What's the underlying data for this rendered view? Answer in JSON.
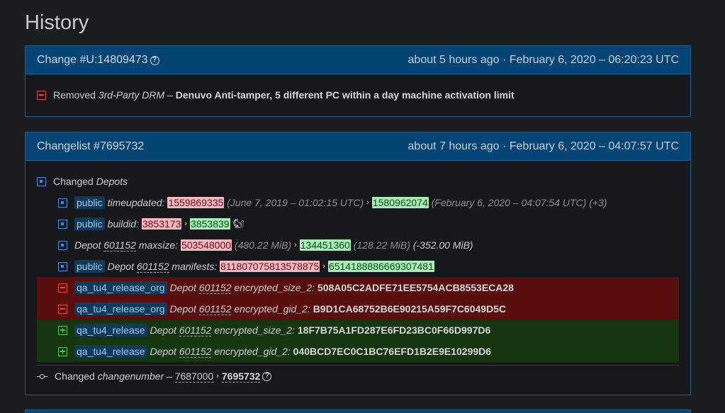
{
  "page": {
    "title": "History"
  },
  "change1": {
    "title": "Change #U:14809473",
    "time": "about 5 hours ago · February 6, 2020 – 06:20:23 UTC",
    "row": {
      "action": "Removed",
      "category": "3rd-Party DRM",
      "dash": "–",
      "value": "Denuvo Anti-tamper, 5 different PC within a day machine activation limit"
    }
  },
  "change2": {
    "title": "Changelist #7695732",
    "time": "about 7 hours ago · February 6, 2020 – 04:07:57 UTC",
    "depots_header": {
      "action": "Changed",
      "category": "Depots"
    },
    "rows": {
      "r1": {
        "tag": "public",
        "key": "timeupdated:",
        "old": "1559869335",
        "old_note": "(June 7, 2019 – 01:02:15 UTC)",
        "new": "1580962074",
        "new_note": "(February 6, 2020 – 04:07:54 UTC) (+3)"
      },
      "r2": {
        "tag": "public",
        "key": "buildid:",
        "old": "3853173",
        "new": "3853839",
        "icon": "squirrel-icon"
      },
      "r3": {
        "depot_label": "Depot",
        "depot_id": "601152",
        "key": "maxsize:",
        "old": "503548000",
        "old_note": "(480.22 MiB)",
        "new": "134451360",
        "new_note": "(128.22 MiB)",
        "delta": "(-352.00 MiB)"
      },
      "r4": {
        "tag": "public",
        "depot_label": "Depot",
        "depot_id": "601152",
        "key": "manifests:",
        "old": "811807075813578875",
        "new": "6514188886669307481"
      },
      "r5": {
        "tag": "qa_tu4_release_org",
        "depot_label": "Depot",
        "depot_id": "601152",
        "key": "encrypted_size_2:",
        "value": "508A05C2ADFE71EE5754ACB8553ECA28"
      },
      "r6": {
        "tag": "qa_tu4_release_org",
        "depot_label": "Depot",
        "depot_id": "601152",
        "key": "encrypted_gid_2:",
        "value": "B9D1CA68752B6E90215A59F7C6049D5C"
      },
      "r7": {
        "tag": "qa_tu4_release",
        "depot_label": "Depot",
        "depot_id": "601152",
        "key": "encrypted_size_2:",
        "value": "18F7B75A1FD287E6FD23BC0F66D997D6"
      },
      "r8": {
        "tag": "qa_tu4_release",
        "depot_label": "Depot",
        "depot_id": "601152",
        "key": "encrypted_gid_2:",
        "value": "040BCD7EC0C1BC76EFD1B2E9E10299D6"
      }
    },
    "changenumber": {
      "action": "Changed",
      "key": "changenumber",
      "dash": "–",
      "old": "7687000",
      "new": "7695732"
    }
  },
  "symbols": {
    "arrow": "›"
  },
  "colors": {
    "header_bg": "#054576",
    "removed": "#e8453c",
    "added": "#4ec94e",
    "changed": "#3b8fe0",
    "row_removed_bg": "#5a0f0f",
    "row_added_bg": "#16360f"
  }
}
